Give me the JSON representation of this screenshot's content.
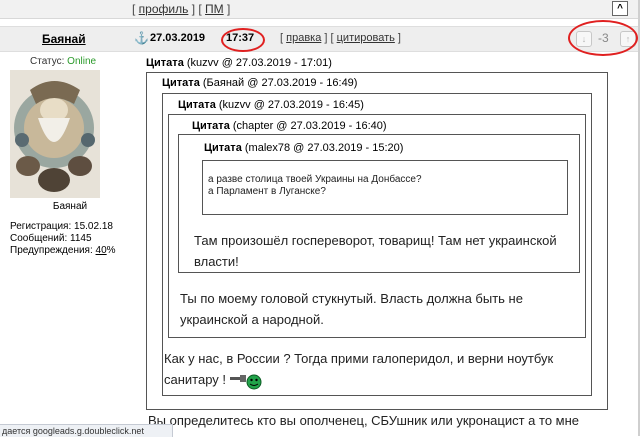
{
  "topbar": {
    "profile_link": "профиль",
    "pm_link": "ПМ",
    "scroll_top": "^"
  },
  "post": {
    "username": "Баянай",
    "date": "27.03.2019",
    "time": "17:37",
    "edit_link": "правка",
    "quote_link": "цитировать",
    "rating": "-3"
  },
  "author": {
    "status_label": "Статус:",
    "status_value": "Online",
    "avatar_name": "Баянай",
    "registration": "Регистрация: 15.02.18",
    "messages": "Сообщений: 1145",
    "warnings_label": "Предупреждения:",
    "warnings_value": "40",
    "warnings_unit": "%"
  },
  "quotes": {
    "label": "Цитата",
    "q1_meta": "(kuzvv @ 27.03.2019 - 17:01)",
    "q2_meta": "(Баянай @ 27.03.2019 - 16:49)",
    "q3_meta": "(kuzvv @ 27.03.2019 - 16:45)",
    "q4_meta": "(chapter @ 27.03.2019 - 16:40)",
    "q5_meta": "(malex78 @ 27.03.2019 - 15:20)",
    "q5_line1": "а разве столица твоей Украины на Донбассе?",
    "q5_line2": "а Парламент в Луганске?",
    "q4_line1": "Там произошёл госпереворот, товарищ! Там нет украинской",
    "q4_line2": "власти!",
    "q3_line1": "Ты по моему головой стукнутый. Власть должна быть не",
    "q3_line2": "украинской а народной.",
    "q2_line1": "Как у нас, в России ? Тогда прими галоперидол, и верни ноутбук",
    "q2_line2": "санитару !",
    "q1_line1": "Вы определитесь кто вы ополченец, СБУшник или укронацист а то мне"
  },
  "statusbar": {
    "text": "дается googleads.g.doubleclick.net"
  },
  "colors": {
    "highlight": "#e02020",
    "online": "#2a9a2a"
  }
}
